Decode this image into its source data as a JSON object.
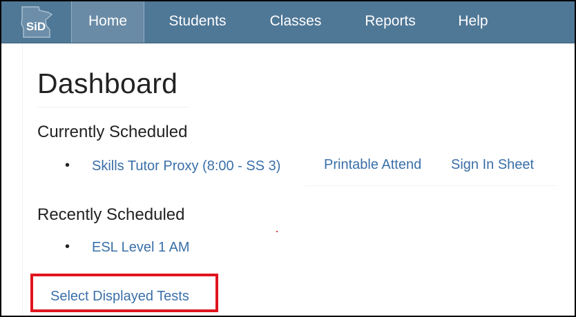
{
  "brand": {
    "logo_text": "SiD",
    "icon": "minnesota-state-logo-icon"
  },
  "nav": {
    "items": [
      {
        "label": "Home",
        "active": true
      },
      {
        "label": "Students",
        "active": false
      },
      {
        "label": "Classes",
        "active": false
      },
      {
        "label": "Reports",
        "active": false
      },
      {
        "label": "Help",
        "active": false
      }
    ]
  },
  "main": {
    "title": "Dashboard",
    "currently_scheduled": {
      "heading": "Currently Scheduled",
      "items": [
        {
          "name": "Skills Tutor Proxy (8:00 - SS 3)",
          "printable_attend": "Printable Attend",
          "sign_in_sheet": "Sign In Sheet"
        }
      ]
    },
    "recently_scheduled": {
      "heading": "Recently Scheduled",
      "items": [
        {
          "name": "ESL Level 1 AM"
        }
      ]
    },
    "select_tests_link": "Select Displayed Tests"
  },
  "colors": {
    "navbar": "#4f7796",
    "nav_active": "#6a8ba6",
    "link": "#3a6fa8",
    "highlight": "#e0141e"
  }
}
